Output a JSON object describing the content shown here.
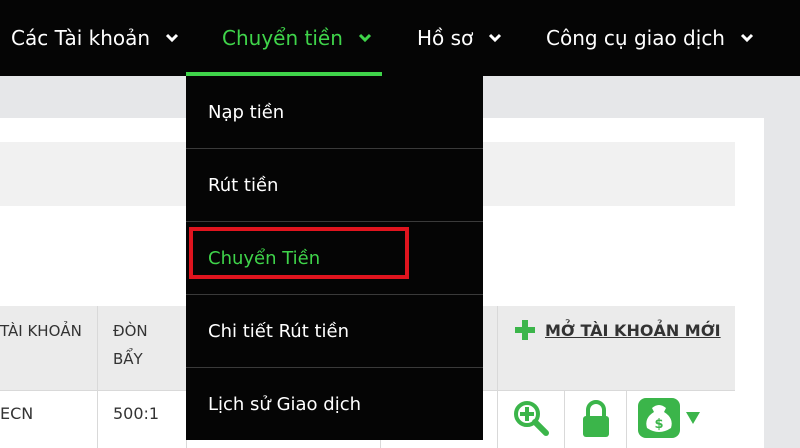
{
  "nav": {
    "items": [
      {
        "label": "Các Tài khoản",
        "active": false
      },
      {
        "label": "Chuyển tiền",
        "active": true
      },
      {
        "label": "Hồ sơ",
        "active": false
      },
      {
        "label": "Công cụ giao dịch",
        "active": false
      }
    ],
    "accent_color": "#3fd44a"
  },
  "dropdown": {
    "items": [
      {
        "label": "Nạp tiền"
      },
      {
        "label": "Rút tiền"
      },
      {
        "label": "Chuyển Tiền",
        "highlighted": true
      },
      {
        "label": "Chi tiết Rút tiền"
      },
      {
        "label": "Lịch sử Giao dịch"
      }
    ],
    "highlight_color": "#e0141e"
  },
  "table": {
    "headers": {
      "account": "TÀI KHOẢN",
      "leverage_line1": "ĐÒN",
      "leverage_line2": "BẨY"
    },
    "open_account_label": "MỞ TÀI KHOẢN MỚI",
    "rows": [
      {
        "account": "ECN",
        "leverage": "500:1"
      }
    ]
  },
  "icons": {
    "nav_chevron": "chevron-down-icon",
    "plus": "plus-icon",
    "zoom": "zoom-in-icon",
    "lock": "lock-icon",
    "money": "money-bag-icon"
  }
}
